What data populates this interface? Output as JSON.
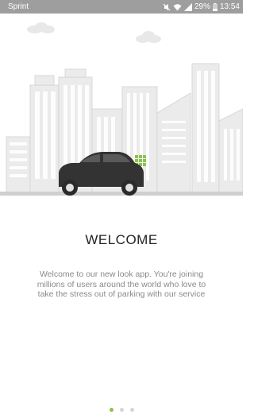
{
  "status_bar": {
    "carrier": "Sprint",
    "battery": "29%",
    "time": "13:54",
    "icons": [
      "mute-icon",
      "wifi-icon",
      "signal-icon",
      "battery-icon"
    ]
  },
  "onboarding": {
    "title": "WELCOME",
    "description": "Welcome to our new look app. You're joining millions of users around the world who love to take the stress out of parking with our service",
    "page_count": 3,
    "active_page": 1
  },
  "colors": {
    "accent": "#8bc34a",
    "status_bar": "#9e9e9e",
    "car": "#333333"
  }
}
